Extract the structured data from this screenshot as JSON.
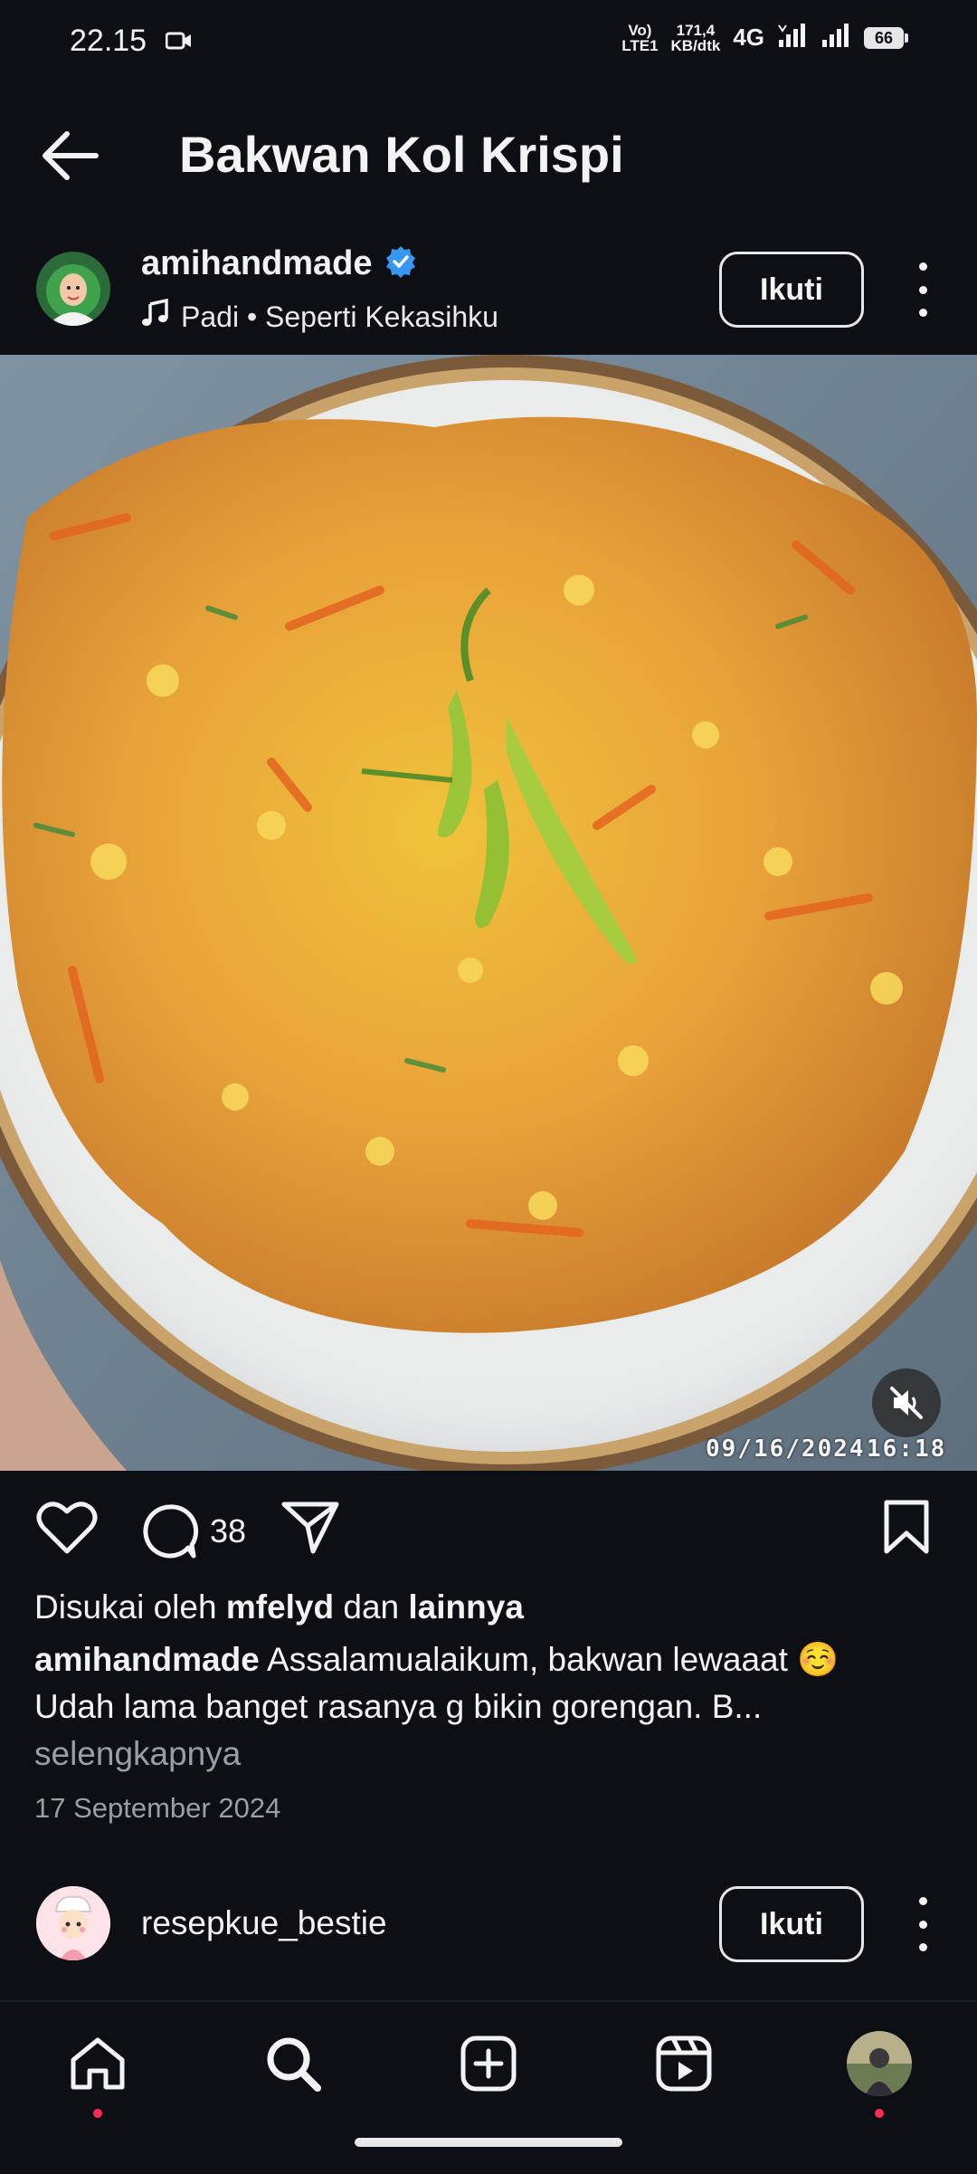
{
  "status_bar": {
    "time": "22.15",
    "volte_line1": "Vo)",
    "volte_line2": "LTE1",
    "speed_value": "171,4",
    "speed_unit": "KB/dtk",
    "network": "4G",
    "battery": "66",
    "icons": [
      "video-camera-icon",
      "signal-icon",
      "signal-icon"
    ]
  },
  "header": {
    "title": "Bakwan Kol Krispi",
    "back_icon": "arrow-left-icon"
  },
  "post": {
    "username": "amihandmade",
    "verified": true,
    "audio": "Padi • Seperti Kekasihku",
    "follow_label": "Ikuti",
    "timestamp_overlay_date": "09/16/2024",
    "timestamp_overlay_time": "16:18",
    "comment_count": "38",
    "likes_prefix": "Disukai oleh",
    "likes_user": "mfelyd",
    "likes_and": "dan",
    "likes_others": "lainnya",
    "caption_user": "amihandmade",
    "caption_line1": "Assalamualaikum, bakwan lewaaat ☺️",
    "caption_line2": "Udah lama banget rasanya g bikin gorengan. B...",
    "more_label": "selengkapnya",
    "date": "17 September 2024"
  },
  "next_post": {
    "username": "resepkue_bestie",
    "follow_label": "Ikuti"
  },
  "nav": {
    "items": [
      "home-icon",
      "search-icon",
      "create-icon",
      "reels-icon",
      "profile-avatar"
    ]
  },
  "colors": {
    "background": "#0c0f14",
    "verified": "#3897f0",
    "notification_dot": "#ff2d55"
  }
}
